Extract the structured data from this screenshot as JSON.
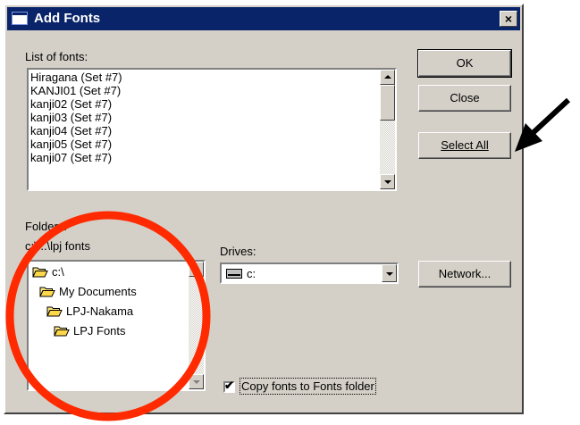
{
  "window": {
    "title": "Add Fonts",
    "close_glyph": "×"
  },
  "fonts_list": {
    "label": "List of fonts:",
    "items": [
      "Hiragana (Set #7)",
      "KANJI01 (Set #7)",
      "kanji02 (Set #7)",
      "kanji03 (Set #7)",
      "kanji04 (Set #7)",
      "kanji05 (Set #7)",
      "kanji07 (Set #7)"
    ]
  },
  "buttons": {
    "ok": "OK",
    "close": "Close",
    "select_all": "Select All",
    "network": "Network..."
  },
  "folders": {
    "label": "Folders:",
    "current_path": "c:\\...\\lpj fonts",
    "items": [
      {
        "name": "c:\\",
        "icon": "open-folder-icon"
      },
      {
        "name": "My Documents",
        "icon": "open-folder-icon"
      },
      {
        "name": "LPJ-Nakama",
        "icon": "open-folder-icon"
      },
      {
        "name": "LPJ Fonts",
        "icon": "open-folder-icon"
      }
    ]
  },
  "drives": {
    "label": "Drives:",
    "selected": "c:",
    "icon": "drive-icon"
  },
  "copy_checkbox": {
    "label": "Copy fonts to Fonts folder",
    "checked": true,
    "mark": "✔"
  },
  "annotations": {
    "arrow_color": "#000000",
    "circle_color": "#ff2a00"
  }
}
